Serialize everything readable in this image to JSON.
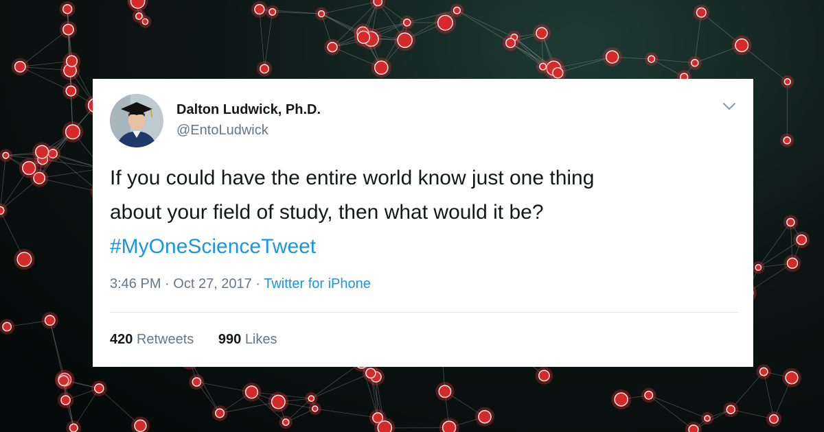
{
  "tweet": {
    "author_name": "Dalton Ludwick, Ph.D.",
    "author_handle": "@EntoLudwick",
    "text_line_1": "If you could have the entire world know just one thing",
    "text_line_2": "about your field of study, then what would it be?",
    "hashtag": "#MyOneScienceTweet",
    "time": "3:46 PM",
    "date": "Oct 27, 2017",
    "source": "Twitter for iPhone",
    "separator": "·",
    "retweets_count": "420",
    "retweets_label": "Retweets",
    "likes_count": "990",
    "likes_label": "Likes"
  },
  "icons": {
    "more_menu": "chevron-down-icon",
    "avatar": "graduation-cap-avatar"
  },
  "colors": {
    "link": "#1b95e0",
    "muted": "#657786",
    "text": "#14171a",
    "node": "#d42a2a"
  }
}
